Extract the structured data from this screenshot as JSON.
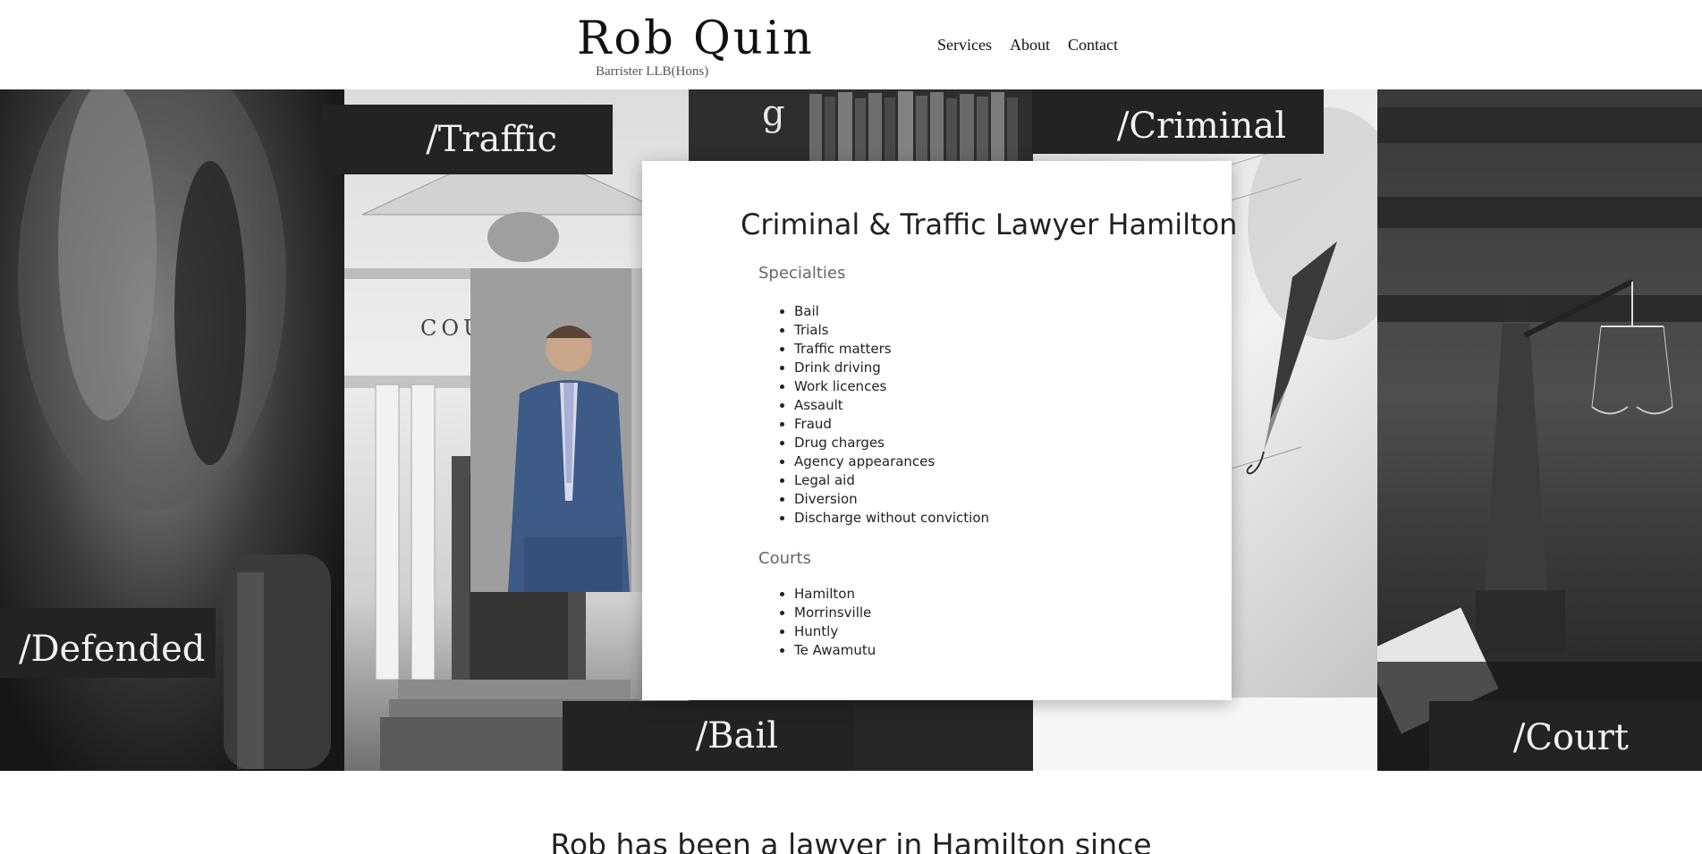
{
  "header": {
    "brand_name": "Rob Quin",
    "brand_subtitle": "Barrister LLB(Hons)",
    "nav": [
      {
        "label": "Services"
      },
      {
        "label": "About"
      },
      {
        "label": "Contact"
      }
    ]
  },
  "hero": {
    "tags": {
      "traffic": "/Traffic",
      "criminal": "/Criminal",
      "defended": "/Defended",
      "bail": "/Bail",
      "court": "/Court"
    },
    "court_sign": "COU",
    "book_letter": "g"
  },
  "card": {
    "title": "Criminal & Traffic Lawyer Hamilton",
    "specialties_heading": "Specialties",
    "specialties": [
      "Bail",
      "Trials",
      "Traffic matters",
      "Drink driving",
      "Work licences",
      "Assault",
      "Fraud",
      "Drug charges",
      "Agency appearances",
      "Legal aid",
      "Diversion",
      "Discharge without conviction"
    ],
    "courts_heading": "Courts",
    "courts": [
      "Hamilton",
      "Morrinsville",
      "Huntly",
      "Te Awamutu"
    ]
  },
  "intro": {
    "text": "Rob has been a lawyer in Hamilton since"
  }
}
